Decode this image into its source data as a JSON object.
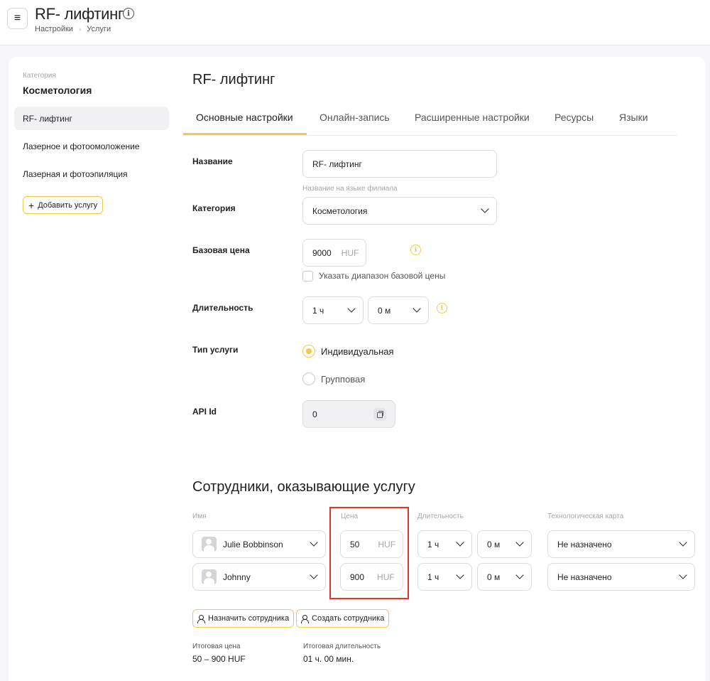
{
  "header": {
    "title": "RF- лифтинг",
    "breadcrumb": [
      "Настройки",
      "Услуги"
    ]
  },
  "sidebar": {
    "category_label": "Категория",
    "category_title": "Косметология",
    "items": [
      {
        "label": "RF- лифтинг",
        "active": true
      },
      {
        "label": "Лазерное и фотоомоложение",
        "active": false
      },
      {
        "label": "Лазерная и фотоэпиляция",
        "active": false
      }
    ],
    "add_button": "Добавить услугу"
  },
  "main": {
    "title": "RF- лифтинг",
    "tabs": [
      {
        "label": "Основные настройки",
        "active": true
      },
      {
        "label": "Онлайн-запись",
        "active": false
      },
      {
        "label": "Расширенные настройки",
        "active": false
      },
      {
        "label": "Ресурсы",
        "active": false
      },
      {
        "label": "Языки",
        "active": false
      }
    ],
    "form": {
      "name_label": "Название",
      "name_value": "RF- лифтинг",
      "name_hint": "Название на языке филиала",
      "category_label": "Категория",
      "category_value": "Косметология",
      "price_label": "Базовая цена",
      "price_value": "9000",
      "price_unit": "HUF",
      "price_range_label": "Указать диапазон базовой цены",
      "duration_label": "Длительность",
      "duration_hours": "1 ч",
      "duration_minutes": "0 м",
      "type_label": "Тип услуги",
      "type_individual": "Индивидуальная",
      "type_group": "Групповая",
      "api_label": "API Id",
      "api_value": "0"
    }
  },
  "staff": {
    "title": "Сотрудники, оказывающие услугу",
    "columns": {
      "name": "Имя",
      "price": "Цена",
      "duration": "Длительность",
      "tech_card": "Технологическая карта"
    },
    "rows": [
      {
        "name": "Julie Bobbinson",
        "price": "50",
        "unit": "HUF",
        "hours": "1 ч",
        "minutes": "0 м",
        "tech_card": "Не назначено"
      },
      {
        "name": "Johnny",
        "price": "900",
        "unit": "HUF",
        "hours": "1 ч",
        "minutes": "0 м",
        "tech_card": "Не назначено"
      }
    ],
    "assign_button": "Назначить сотрудника",
    "create_button": "Создать сотрудника",
    "total_price_label": "Итоговая цена",
    "total_price_value": "50 – 900 HUF",
    "total_duration_label": "Итоговая длительность",
    "total_duration_value": "01 ч. 00 мин."
  },
  "colors": {
    "accent": "#f3c94a",
    "highlight": "#e0352b"
  }
}
